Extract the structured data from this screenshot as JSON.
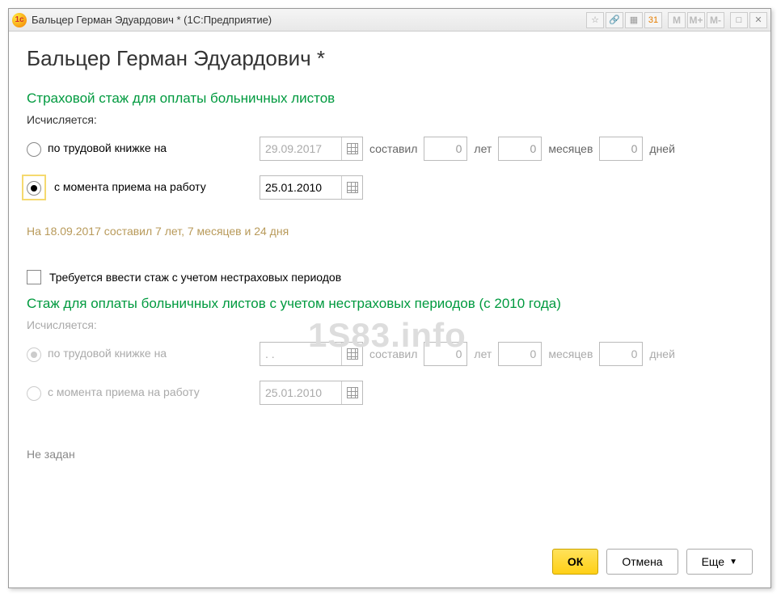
{
  "window": {
    "title": "Бальцер Герман Эдуардович * (1С:Предприятие)",
    "icon": "1c"
  },
  "toolbar_buttons": {
    "m": "M",
    "mplus": "M+",
    "mminus": "M-"
  },
  "page": {
    "title": "Бальцер Герман Эдуардович *"
  },
  "section1": {
    "heading": "Страховой стаж для оплаты больничных листов",
    "calc_label": "Исчисляется:",
    "opt1_label": "по трудовой книжке на",
    "opt1_date": "29.09.2017",
    "composed": "составил",
    "years_val": "0",
    "years_unit": "лет",
    "months_val": "0",
    "months_unit": "месяцев",
    "days_val": "0",
    "days_unit": "дней",
    "opt2_label": "с момента приема на работу",
    "opt2_date": "25.01.2010",
    "summary": "На 18.09.2017 составил 7 лет, 7 месяцев и 24 дня"
  },
  "checkbox": {
    "label": "Требуется ввести стаж с учетом нестраховых периодов"
  },
  "section2": {
    "heading": "Стаж для оплаты больничных листов с учетом нестраховых периодов (с 2010 года)",
    "calc_label": "Исчисляется:",
    "opt1_label": "по трудовой книжке на",
    "opt1_date": "  .  .    ",
    "composed": "составил",
    "years_val": "0",
    "years_unit": "лет",
    "months_val": "0",
    "months_unit": "месяцев",
    "days_val": "0",
    "days_unit": "дней",
    "opt2_label": "с момента приема на работу",
    "opt2_date": "25.01.2010",
    "not_set": "Не задан"
  },
  "footer": {
    "ok": "ОК",
    "cancel": "Отмена",
    "more": "Еще"
  },
  "watermark": "1S83.info"
}
